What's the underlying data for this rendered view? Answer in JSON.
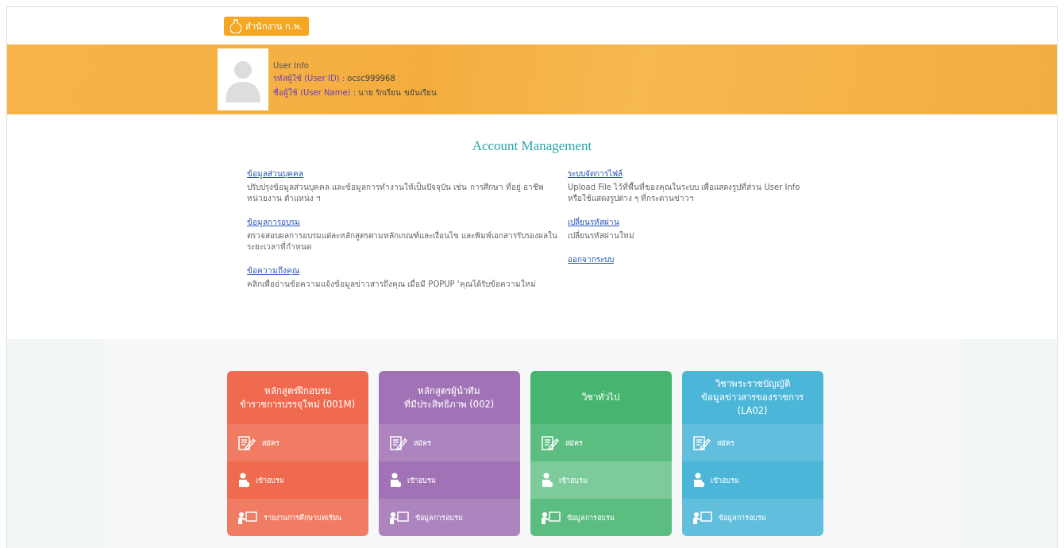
{
  "header": {
    "logo_text": "สำนักงาน ก.พ."
  },
  "user_info": {
    "title": "User Info",
    "lines": [
      {
        "label": "รหัสผู้ใช้ (User ID) : ",
        "value": "ocsc999968"
      },
      {
        "label": "ชื่อผู้ใช้ (User Name) : ",
        "value": "นาย   รักเรียน   ขยันเรียน"
      }
    ]
  },
  "account": {
    "title": "Account Management",
    "columns": [
      [
        {
          "link": "ข้อมูลส่วนบุคคล",
          "description": "ปรับปรุงข้อมูลส่วนบุคคล และข้อมูลการทำงานให้เป็นปัจจุบัน เช่น การศึกษา ที่อยู่ อาชีพ หน่วยงาน ตำแหน่ง ฯ"
        },
        {
          "link": "ข้อมูลการอบรม",
          "description": "ตรวจสอบผลการอบรมแต่ละหลักสูตรตามหลักเกณฑ์และเงื่อนไข และพิมพ์เอกสารรับรองผลในระยะเวลาที่กำหนด"
        },
        {
          "link": "ข้อความถึงคุณ",
          "description": "คลิกเพื่ออ่านข้อความแจ้งข้อมูลข่าวสารถึงคุณ เมื่อมี POPUP 'คุณได้รับข้อความใหม่"
        }
      ],
      [
        {
          "link": "ระบบจัดการไฟล์",
          "description": "Upload File ไว้ที่พื้นที่ของคุณในระบบ เพื่อแสดงรูปที่ส่วน User Info หรือใช้แสดงรูปต่าง ๆ ที่กระดานข่าวฯ"
        },
        {
          "link": "เปลี่ยนรหัสผ่าน",
          "description": "เปลี่ยนรหัสผ่านใหม่"
        },
        {
          "link": "ออกจากระบบ"
        }
      ]
    ]
  },
  "courses": [
    {
      "title_lines": [
        "หลักสูตรฝึกอบรม",
        "ข้าราชการบรรจุใหม่ (001M)"
      ],
      "color": "#ef6a4f",
      "rows": [
        {
          "kind": "apply",
          "label": "สมัคร",
          "highlighted": false
        },
        {
          "kind": "enter",
          "label": "เข้าอบรม",
          "highlighted": false
        },
        {
          "kind": "info",
          "label": "รายงานการศึกษาบทเรียน",
          "highlighted": false
        }
      ]
    },
    {
      "title_lines": [
        "หลักสูตรผู้นำทีม",
        "ที่มีประสิทธิภาพ (002)"
      ],
      "color": "#a173b6",
      "rows": [
        {
          "kind": "apply",
          "label": "สมัคร",
          "highlighted": false
        },
        {
          "kind": "enter",
          "label": "เข้าอบรม",
          "highlighted": false
        },
        {
          "kind": "info",
          "label": "ข้อมูลการอบรม",
          "highlighted": false
        }
      ]
    },
    {
      "title_lines": [
        "วิชาทั่วไป"
      ],
      "color": "#45b56f",
      "rows": [
        {
          "kind": "apply",
          "label": "สมัคร",
          "highlighted": false
        },
        {
          "kind": "enter",
          "label": "เข้าอบรม",
          "highlighted": true
        },
        {
          "kind": "info",
          "label": "ข้อมูลการอบรม",
          "highlighted": false
        }
      ]
    },
    {
      "title_lines": [
        "วิชาพระราชบัญญัติ",
        "ข้อมูลข่าวสารของราชการ",
        "(LA02)"
      ],
      "color": "#4cb6d9",
      "rows": [
        {
          "kind": "apply",
          "label": "สมัคร",
          "highlighted": false
        },
        {
          "kind": "enter",
          "label": "เข้าอบรม",
          "highlighted": false
        },
        {
          "kind": "info",
          "label": "ข้อมูลการอบรม",
          "highlighted": false
        }
      ]
    }
  ]
}
